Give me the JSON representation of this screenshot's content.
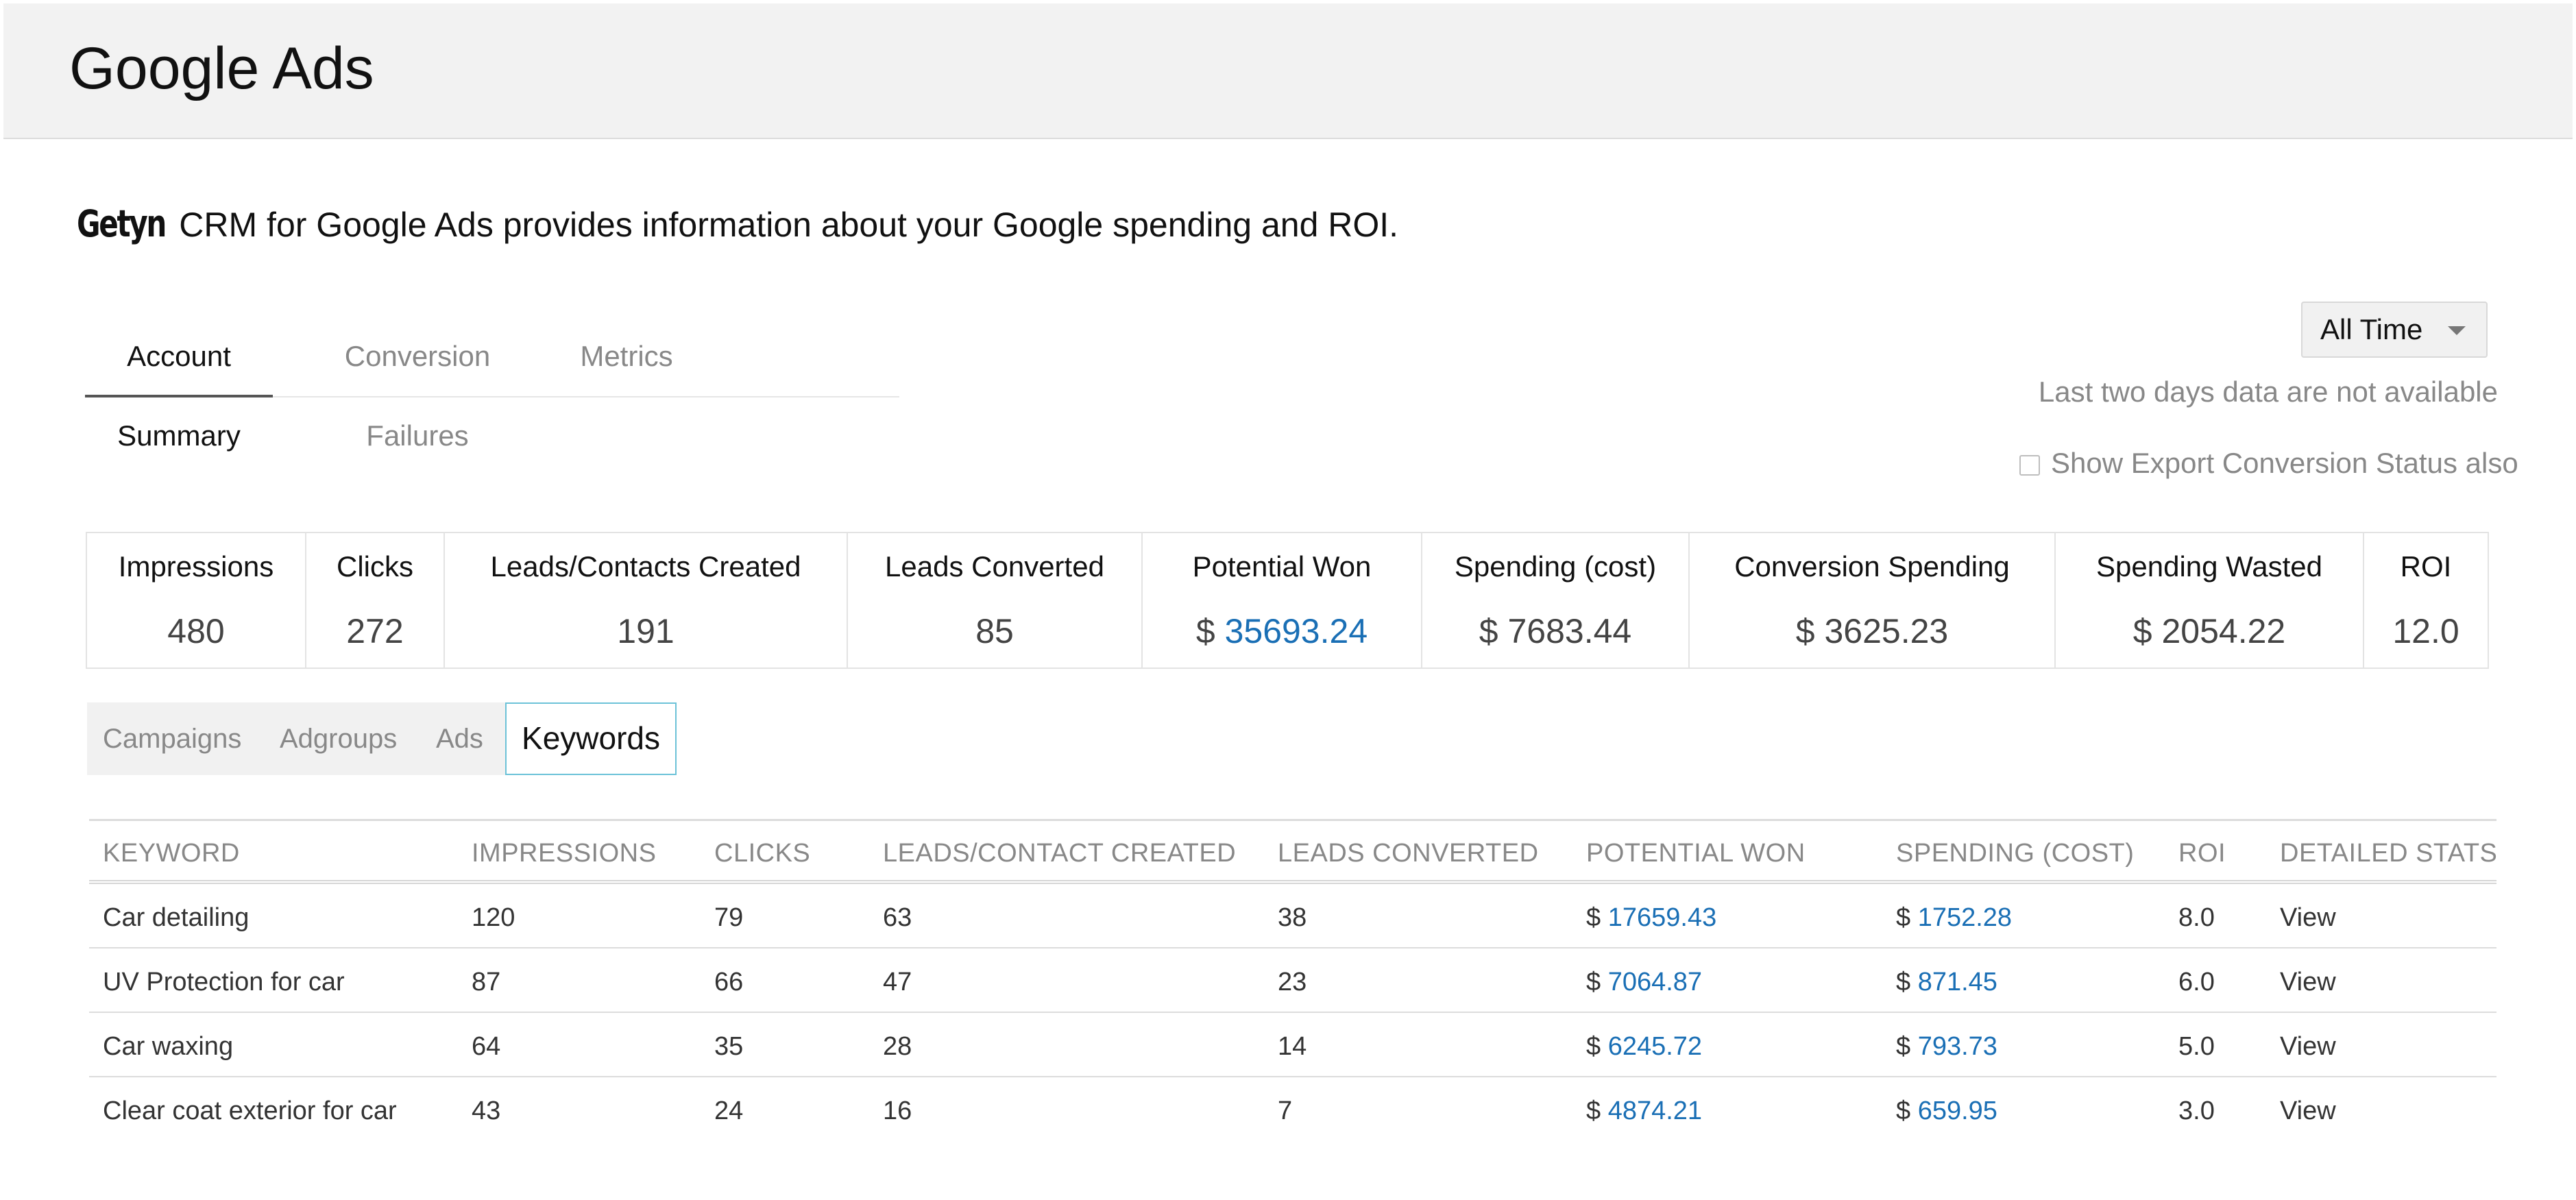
{
  "header": {
    "title": "Google Ads"
  },
  "intro": {
    "brand": "Getyn",
    "text": " CRM for Google Ads provides information about your Google spending and ROI."
  },
  "tabs": [
    {
      "label": "Account Summary",
      "active": true
    },
    {
      "label": "Conversion Failures",
      "active": false
    },
    {
      "label": "Metrics",
      "active": false
    }
  ],
  "range": {
    "selected": "All Time"
  },
  "notice": "Last two days data are not available",
  "export": {
    "label": "Show Export Conversion Status also",
    "checked": false
  },
  "summary": [
    {
      "label": "Impressions",
      "value": "480"
    },
    {
      "label": "Clicks",
      "value": "272"
    },
    {
      "label": "Leads/Contacts Created",
      "value": "191"
    },
    {
      "label": "Leads Converted",
      "value": "85"
    },
    {
      "label": "Potential Won",
      "currency": "$ ",
      "value": "35693.24"
    },
    {
      "label": "Spending (cost)",
      "value": "$ 7683.44"
    },
    {
      "label": "Conversion Spending",
      "value": "$ 3625.23"
    },
    {
      "label": "Spending Wasted",
      "value": "$ 2054.22"
    },
    {
      "label": "ROI",
      "value": "12.0"
    }
  ],
  "subtabs": [
    {
      "label": "Campaigns",
      "active": false
    },
    {
      "label": "Adgroups",
      "active": false
    },
    {
      "label": "Ads",
      "active": false
    },
    {
      "label": "Keywords",
      "active": true
    }
  ],
  "table": {
    "columns": [
      "KEYWORD",
      "IMPRESSIONS",
      "CLICKS",
      "LEADS/CONTACT CREATED",
      "LEADS CONVERTED",
      "POTENTIAL WON",
      "SPENDING (COST)",
      "ROI",
      "DETAILED STATS"
    ],
    "currency": "$",
    "rows": [
      {
        "keyword": "Car detailing",
        "impressions": "120",
        "clicks": "79",
        "leads": "63",
        "converted": "38",
        "won": "17659.43",
        "cost": "1752.28",
        "roi": "8.0",
        "stats": "View"
      },
      {
        "keyword": "UV Protection for car",
        "impressions": "87",
        "clicks": "66",
        "leads": "47",
        "converted": "23",
        "won": "7064.87",
        "cost": "871.45",
        "roi": "6.0",
        "stats": "View"
      },
      {
        "keyword": "Car waxing",
        "impressions": "64",
        "clicks": "35",
        "leads": "28",
        "converted": "14",
        "won": "6245.72",
        "cost": "793.73",
        "roi": "5.0",
        "stats": "View"
      },
      {
        "keyword": "Clear coat exterior for car",
        "impressions": "43",
        "clicks": "24",
        "leads": "16",
        "converted": "7",
        "won": "4874.21",
        "cost": "659.95",
        "roi": "3.0",
        "stats": "View"
      }
    ]
  },
  "colors": {
    "link": "#1a6fb5",
    "muted": "#888888",
    "activeTabBorder": "#6cc2d8"
  }
}
